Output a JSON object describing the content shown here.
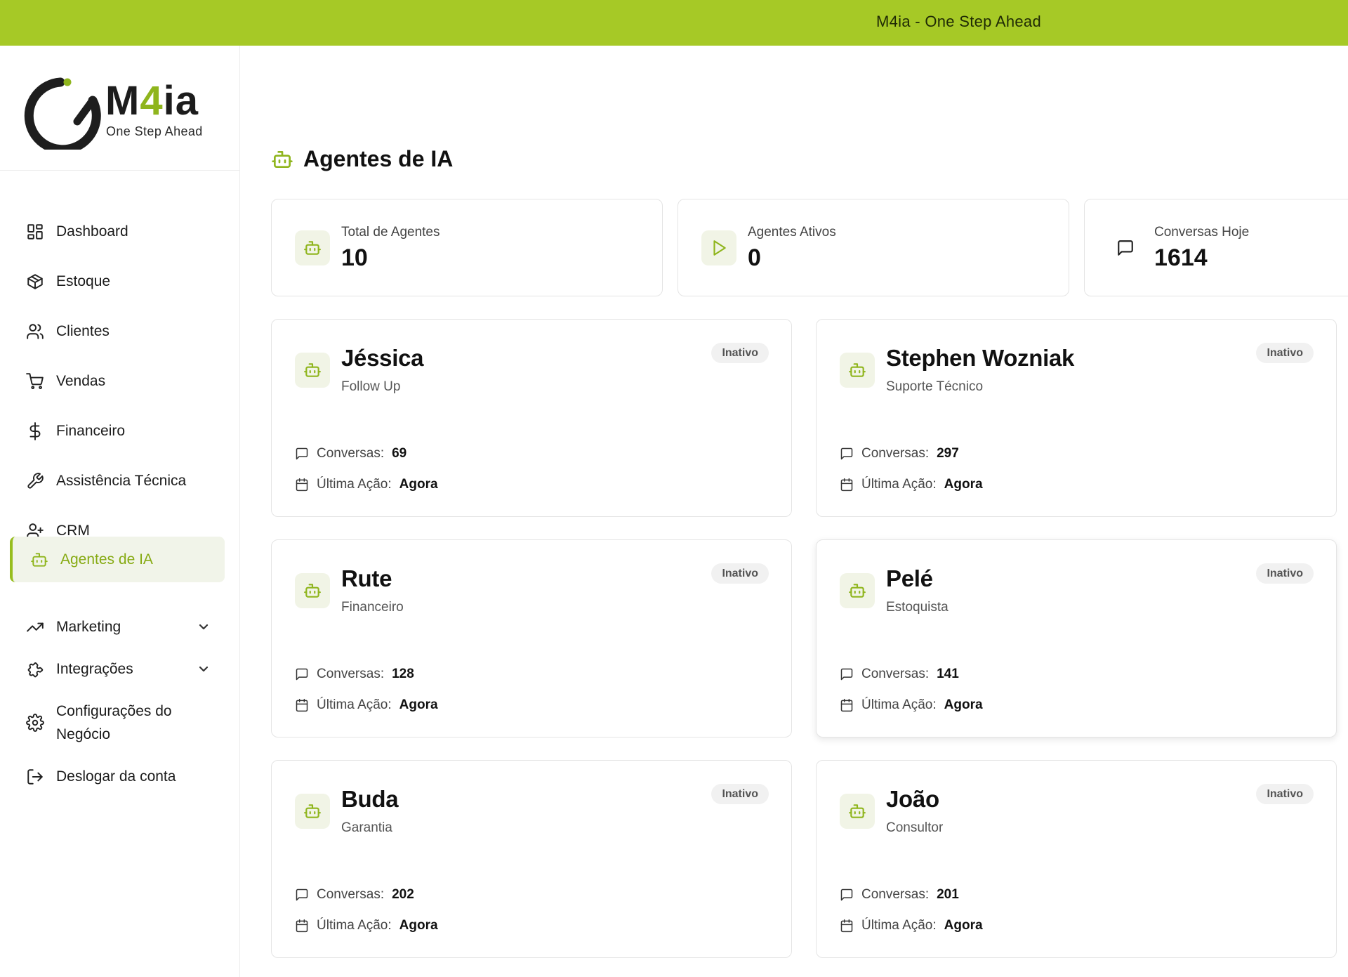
{
  "topbar": {
    "title": "M4ia - One Step Ahead"
  },
  "brand": {
    "logo_prefix": "M",
    "logo_digit": "4",
    "logo_suffix": "ia",
    "tagline": "One Step Ahead",
    "accent_color": "#a6c926",
    "accent_dark": "#8fb51d"
  },
  "sidebar": {
    "items": [
      {
        "label": "Dashboard",
        "icon": "dashboard-grid-icon"
      },
      {
        "label": "Estoque",
        "icon": "package-icon"
      },
      {
        "label": "Clientes",
        "icon": "users-icon"
      },
      {
        "label": "Vendas",
        "icon": "shopping-cart-icon"
      },
      {
        "label": "Financeiro",
        "icon": "dollar-icon"
      },
      {
        "label": "Assistência Técnica",
        "icon": "wrench-icon"
      },
      {
        "label": "CRM",
        "icon": "user-plus-icon"
      },
      {
        "label": "Agentes de IA",
        "icon": "bot-icon",
        "active": true
      },
      {
        "label": "Marketing",
        "icon": "trending-up-icon",
        "expandable": true
      },
      {
        "label": "Integrações",
        "icon": "puzzle-icon",
        "expandable": true
      },
      {
        "label": "Configurações do Negócio",
        "icon": "settings-gear-icon"
      },
      {
        "label": "Deslogar da conta",
        "icon": "logout-icon"
      }
    ]
  },
  "main": {
    "title": "Agentes de IA",
    "stats": [
      {
        "label": "Total de Agentes",
        "value": "10",
        "icon": "bot-icon"
      },
      {
        "label": "Agentes Ativos",
        "value": "0",
        "icon": "play-icon"
      },
      {
        "label": "Conversas Hoje",
        "value": "1614",
        "icon": "message-square-icon"
      }
    ],
    "meta_labels": {
      "conversations": "Conversas:",
      "last_action": "Última Ação:"
    },
    "agents": [
      {
        "name": "Jéssica",
        "role": "Follow Up",
        "status": "Inativo",
        "conversations": "69",
        "last_action": "Agora"
      },
      {
        "name": "Stephen Wozniak",
        "role": "Suporte Técnico",
        "status": "Inativo",
        "conversations": "297",
        "last_action": "Agora"
      },
      {
        "name": "Rute",
        "role": "Financeiro",
        "status": "Inativo",
        "conversations": "128",
        "last_action": "Agora"
      },
      {
        "name": "Pelé",
        "role": "Estoquista",
        "status": "Inativo",
        "conversations": "141",
        "last_action": "Agora"
      },
      {
        "name": "Buda",
        "role": "Garantia",
        "status": "Inativo",
        "conversations": "202",
        "last_action": "Agora"
      },
      {
        "name": "João",
        "role": "Consultor",
        "status": "Inativo",
        "conversations": "201",
        "last_action": "Agora"
      }
    ]
  }
}
